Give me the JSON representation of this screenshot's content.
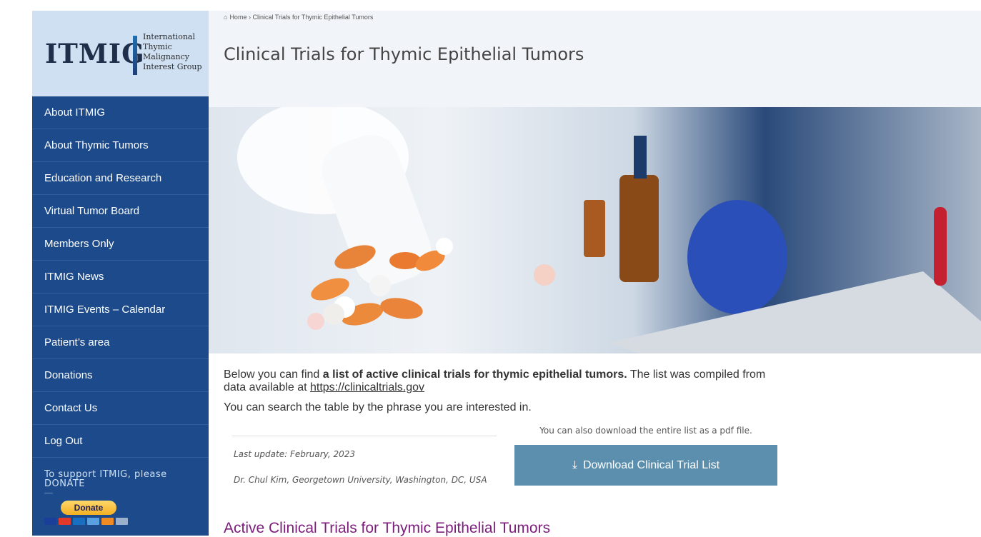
{
  "logo": {
    "main": "ITMIG",
    "sub_lines": [
      "International",
      "Thymic",
      "Malignancy",
      "Interest Group"
    ]
  },
  "sidebar": {
    "items": [
      {
        "label": "About ITMIG"
      },
      {
        "label": "About Thymic Tumors"
      },
      {
        "label": "Education and Research"
      },
      {
        "label": "Virtual Tumor Board"
      },
      {
        "label": "Members Only"
      },
      {
        "label": "ITMIG News"
      },
      {
        "label": "ITMIG Events – Calendar"
      },
      {
        "label": "Patient’s area"
      },
      {
        "label": "Donations"
      },
      {
        "label": "Contact Us"
      },
      {
        "label": "Log Out"
      }
    ],
    "support_text": "To support ITMIG, please DONATE",
    "donate_label": "Donate"
  },
  "breadcrumb": {
    "home": "Home",
    "separator": "›",
    "current": "Clinical Trials for Thymic Epithelial Tumors"
  },
  "page_title": "Clinical Trials for Thymic Epithelial Tumors",
  "content": {
    "intro_pre": "Below you can find ",
    "intro_bold": "a list of active clinical trials for thymic epithelial tumors.",
    "intro_post": " The list was compiled from data available at ",
    "intro_link": "https://clinicaltrials.gov",
    "search_note": "You can search the table by the phrase you are interested in.",
    "last_update": "Last update: February, 2023",
    "author": "Dr. Chul Kim, Georgetown University, Washington, DC, USA",
    "download_note": "You can also download the entire list as a pdf file.",
    "download_label": "Download Clinical Trial List",
    "section_title": "Active Clinical Trials for Thymic Epithelial Tumors"
  },
  "colors": {
    "sidebar_bg": "#1c4a8a",
    "logo_bg": "#cfe0f2",
    "download_btn": "#5b8fad",
    "section_title": "#7b1d7a"
  }
}
